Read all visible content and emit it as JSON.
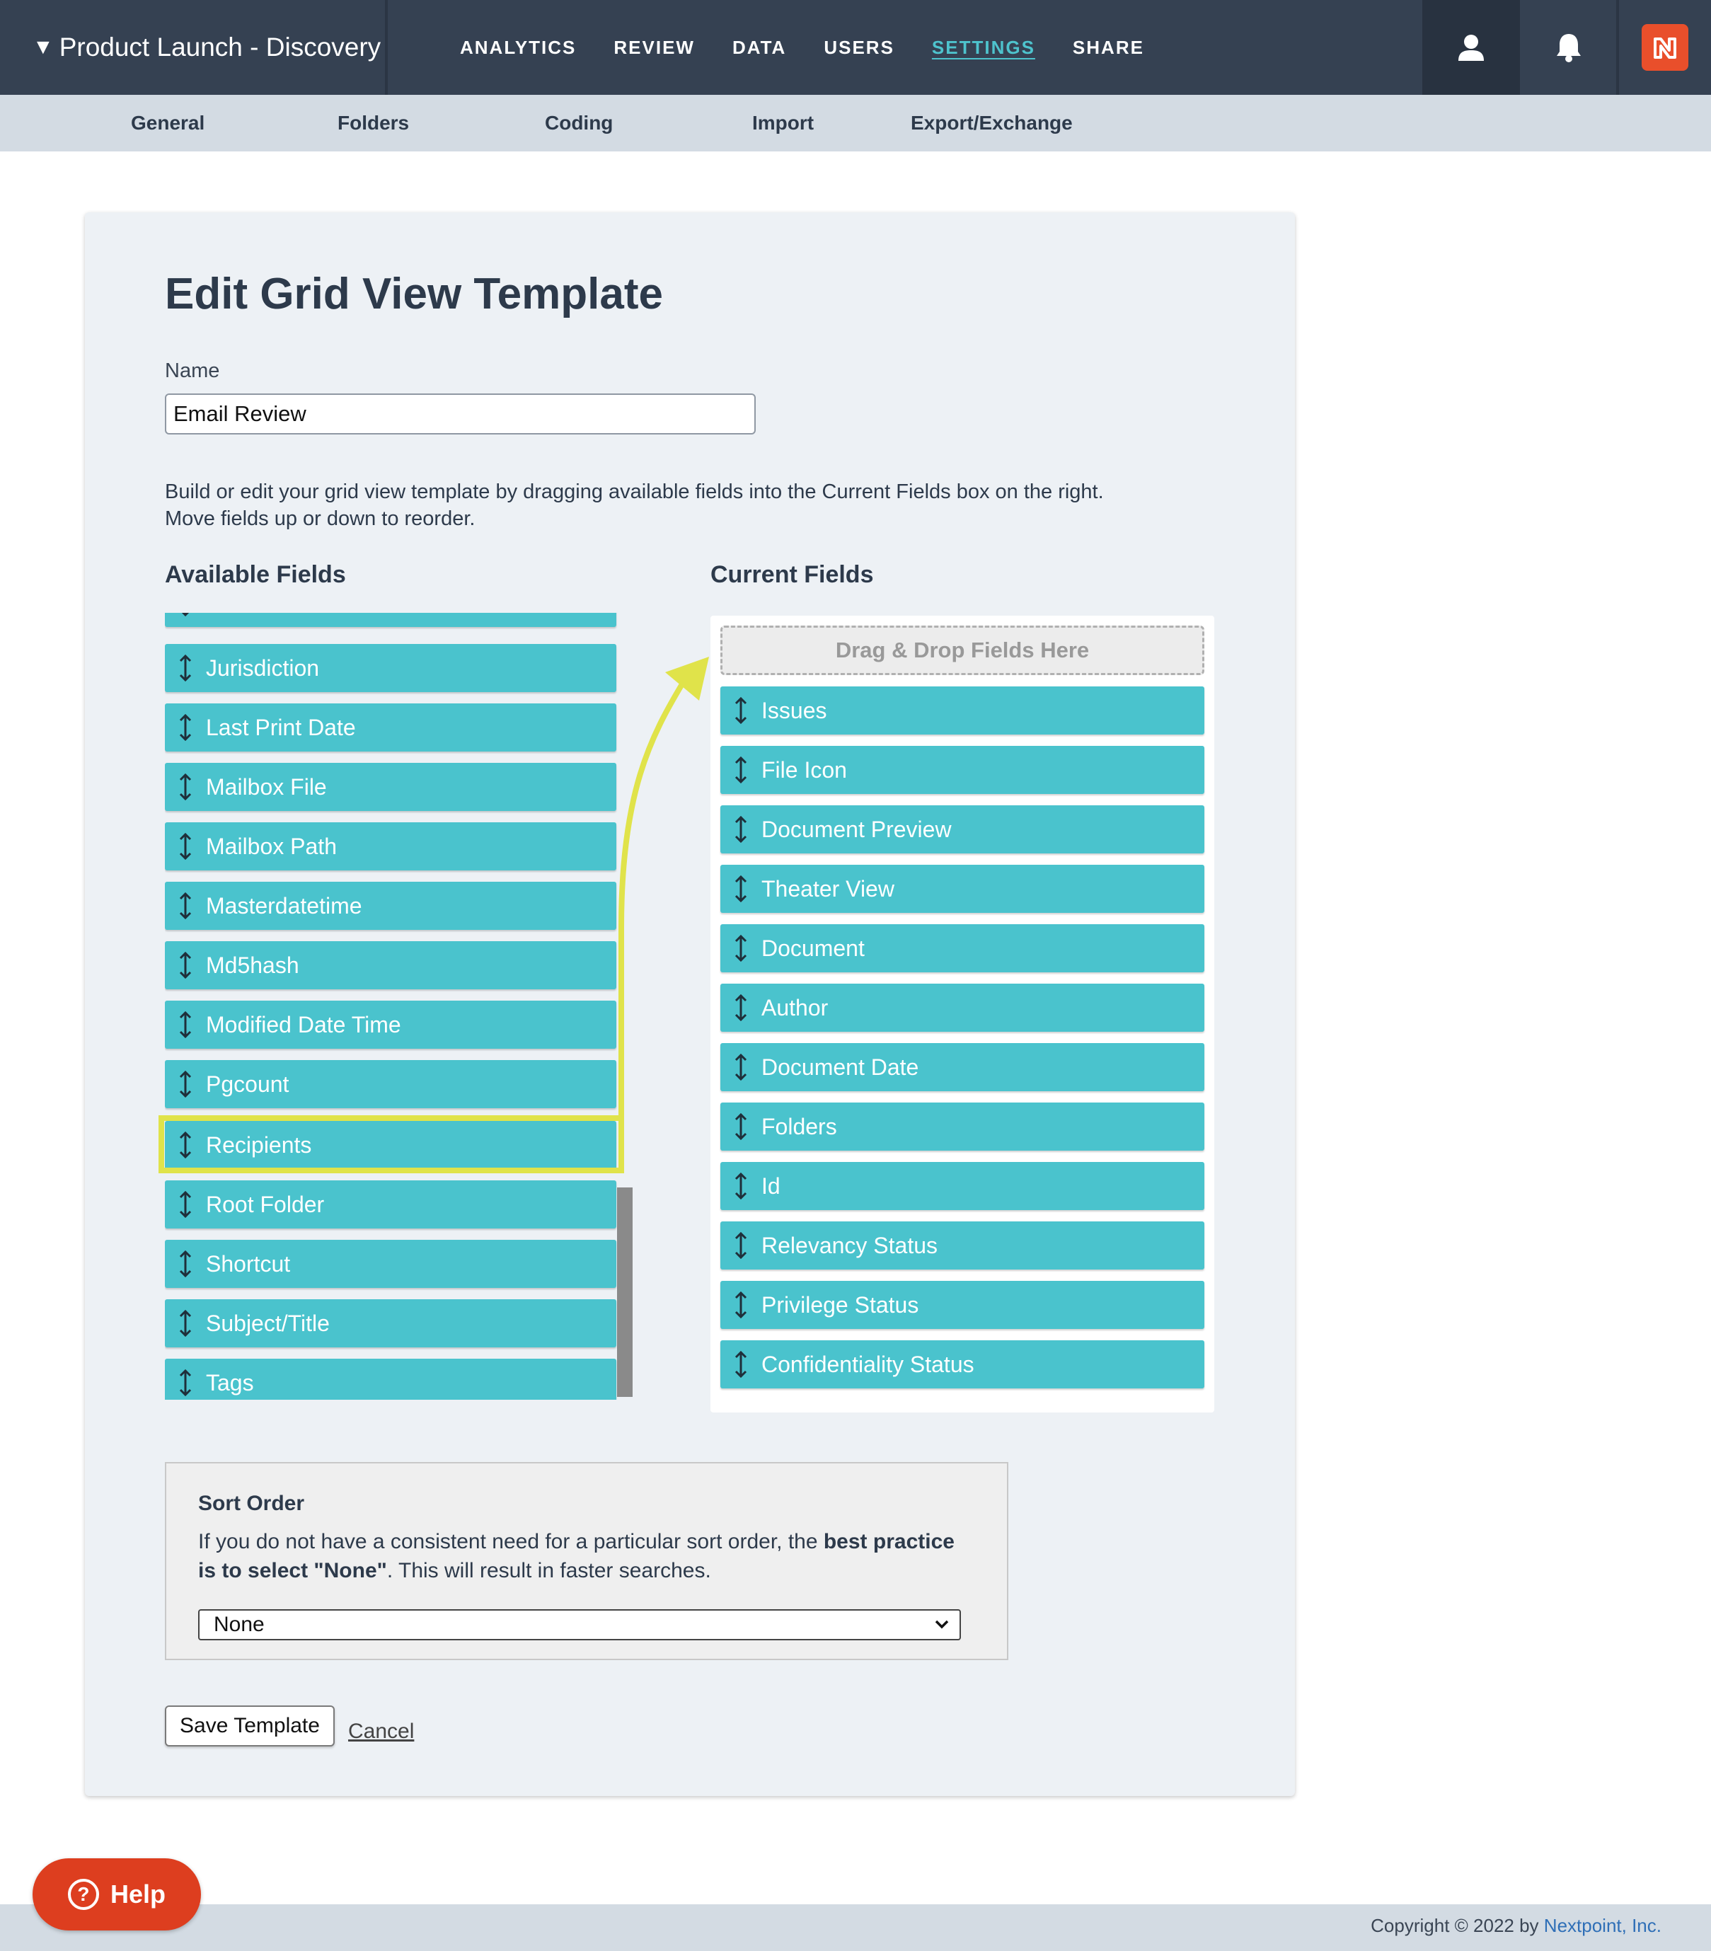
{
  "header": {
    "project_name": "Product Launch - Discovery",
    "nav": [
      "ANALYTICS",
      "REVIEW",
      "DATA",
      "USERS",
      "SETTINGS",
      "SHARE"
    ],
    "active_nav": "SETTINGS",
    "icons": [
      "user-icon",
      "bell-icon",
      "nextpoint-logo-icon"
    ]
  },
  "subnav": [
    "General",
    "Folders",
    "Coding",
    "Import",
    "Export/Exchange"
  ],
  "form": {
    "title": "Edit Grid View Template",
    "name_label": "Name",
    "name_value": "Email Review",
    "description_line1": "Build or edit your grid view template by dragging available fields into the Current Fields box on the right.",
    "description_line2": "Move fields up or down to reorder.",
    "available_heading": "Available Fields",
    "current_heading": "Current Fields",
    "available_fields": [
      "Jurisdiction",
      "Last Print Date",
      "Mailbox File",
      "Mailbox Path",
      "Masterdatetime",
      "Md5hash",
      "Modified Date Time",
      "Pgcount",
      "Recipients",
      "Root Folder",
      "Shortcut",
      "Subject/Title",
      "Tags"
    ],
    "highlighted_field": "Recipients",
    "dropzone_label": "Drag & Drop Fields Here",
    "current_fields": [
      "Issues",
      "File Icon",
      "Document Preview",
      "Theater View",
      "Document",
      "Author",
      "Document Date",
      "Folders",
      "Id",
      "Relevancy Status",
      "Privilege Status",
      "Confidentiality Status"
    ],
    "highlight_color": "#e0e34a"
  },
  "sort": {
    "title": "Sort Order",
    "text_plain": "If you do not have a consistent need for a particular sort order, the ",
    "text_bold": "best practice is to select \"None\"",
    "text_end": ". This will result in faster searches.",
    "selected": "None"
  },
  "actions": {
    "save_label": "Save Template",
    "cancel_label": "Cancel"
  },
  "footer": {
    "copyright_prefix": "Copyright © 2022 by ",
    "company": "Nextpoint, Inc.",
    "help_label": "Help"
  },
  "colors": {
    "topbar": "#354152",
    "accent": "#4ec3cd",
    "field": "#4ac3cd",
    "help": "#dd3e1f",
    "logo": "#e94f2b"
  }
}
